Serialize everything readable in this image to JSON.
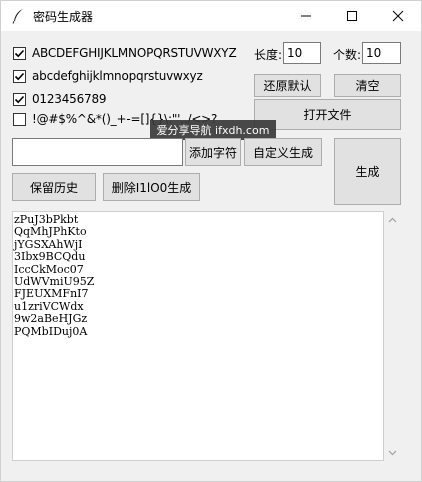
{
  "window": {
    "title": "密码生成器"
  },
  "charsets": [
    {
      "label": "ABCDEFGHIJKLMNOPQRSTUVWXYZ",
      "checked": true
    },
    {
      "label": "abcdefghijklmnopqrstuvwxyz",
      "checked": true
    },
    {
      "label": "0123456789",
      "checked": true
    },
    {
      "label": "!@#$%^&*()_+-=[]{}\\:\"',./<>?",
      "checked": false
    }
  ],
  "length": {
    "label": "长度:",
    "value": "10"
  },
  "count": {
    "label": "个数:",
    "value": "10"
  },
  "buttons": {
    "restore_default": "还原默认",
    "clear": "清空",
    "open_file": "打开文件",
    "add_chars": "添加字符",
    "custom_generate": "自定义生成",
    "generate": "生成",
    "keep_history": "保留历史",
    "remove_ambiguous": "删除I1lO0生成"
  },
  "custom_input": {
    "value": ""
  },
  "tooltip": {
    "text": "爱分享导航 ifxdh.com"
  },
  "output": {
    "lines": [
      "zPuJ3bPkbt",
      "QqMhJPhKto",
      "jYGSXAhWjI",
      "3Ibx9BCQdu",
      "IccCkMoc07",
      "UdWVmiU95Z",
      "FJEUXMFnI7",
      "u1zriVCWdx",
      "9w2aBeHJGz",
      "PQMbIDuj0A"
    ]
  }
}
